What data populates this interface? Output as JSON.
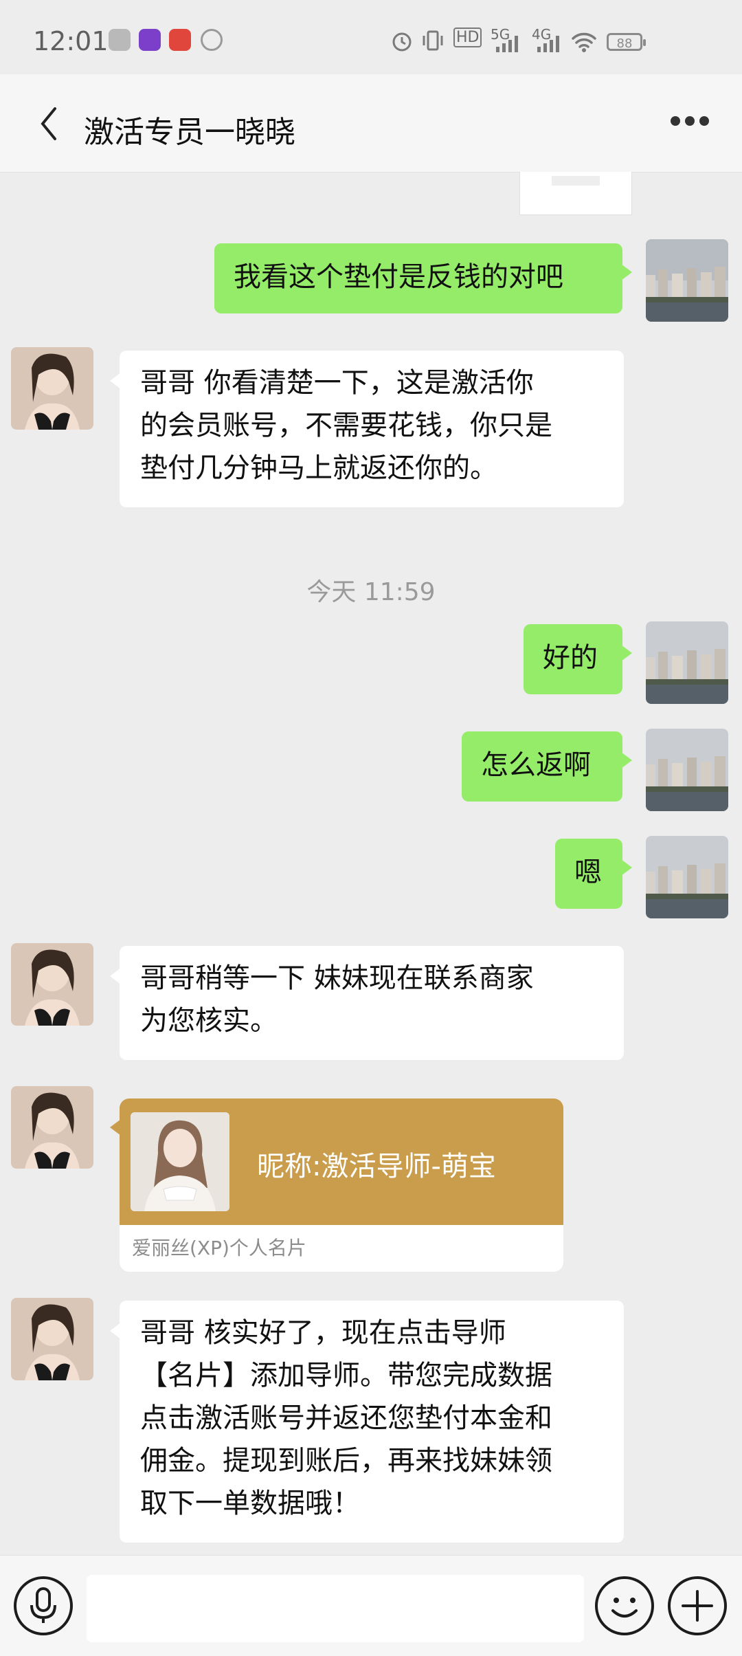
{
  "status_bar": {
    "time": "12:01",
    "network_hd": "HD",
    "network_5g": "5G",
    "network_4g": "4G",
    "battery": "88"
  },
  "header": {
    "title": "激活专员一晓晓"
  },
  "messages": {
    "m1": "我看这个垫付是反钱的对吧",
    "m2_lines": [
      "哥哥  你看清楚一下，这是激活你",
      "的会员账号，不需要花钱，你只是",
      "垫付几分钟马上就返还你的。"
    ],
    "timestamp": "今天 11:59",
    "m3": "好的",
    "m4": "怎么返啊",
    "m5": "嗯",
    "m6_lines": [
      "哥哥稍等一下 妹妹现在联系商家",
      "为您核实。"
    ],
    "m7_lines": [
      "哥哥   核实好了，现在点击导师",
      "【名片】添加导师。带您完成数据",
      "点击激活账号并返还您垫付本金和",
      "佣金。提现到账后，再来找妹妹领",
      "取下一单数据哦！"
    ]
  },
  "contact_card": {
    "nickname": "昵称:激活导师-萌宝",
    "footer": "爱丽丝(XP)个人名片"
  },
  "input_bar": {
    "value": ""
  },
  "icons": {
    "back": "chevron-left-icon",
    "more": "more-dots-icon",
    "voice": "microphone-icon",
    "emoji": "smiley-icon",
    "add": "plus-icon"
  },
  "colors": {
    "outgoing_bubble": "#95ec69",
    "incoming_bubble": "#ffffff",
    "card_header": "#c99d4b",
    "background": "#ededed"
  }
}
